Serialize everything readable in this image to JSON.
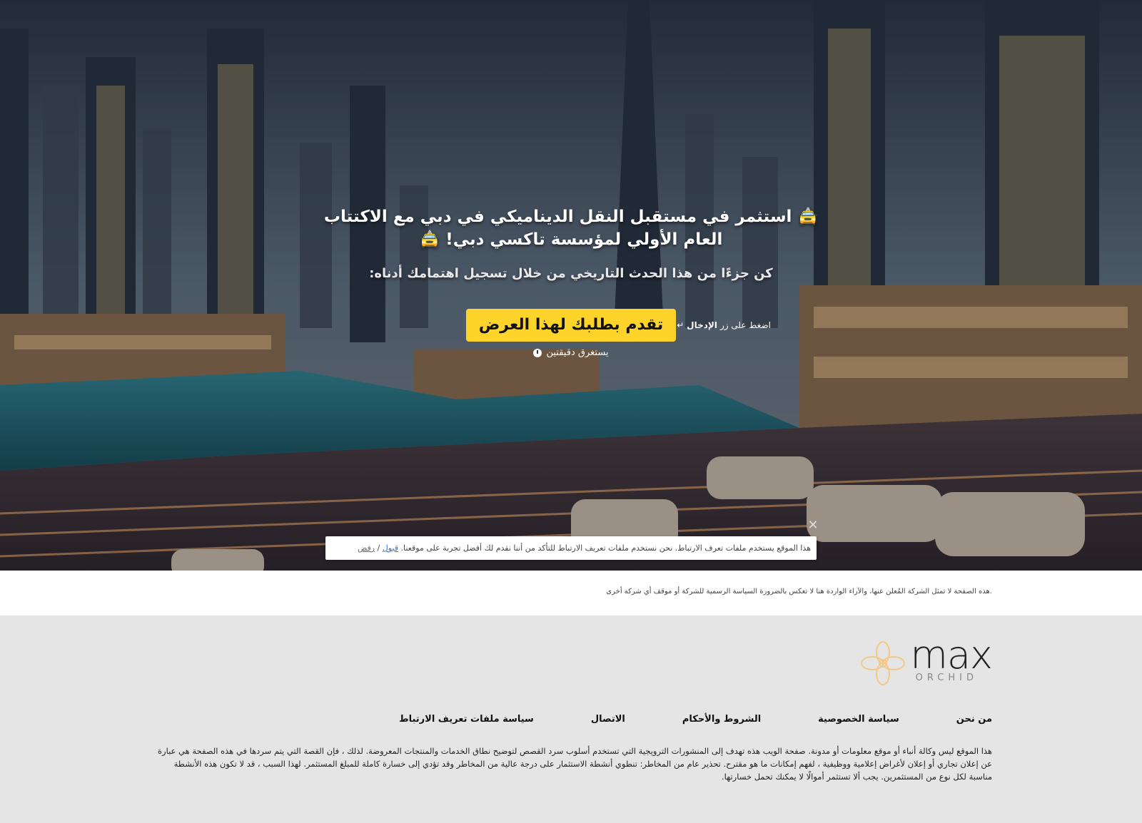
{
  "hero": {
    "title": "🚖 استثمر في مستقبل النقل الديناميكي في دبي مع الاكتتاب العام الأولي لمؤسسة تاكسي دبي! 🚖",
    "subtitle": "كن جزءًا من هذا الحدث التاريخي من خلال تسجيل اهتمامك أدناه:",
    "cta_label": "تقدم بطلبك لهذا العرض",
    "enter_hint_prefix": "اضغط على زر",
    "enter_hint_key": "الإدخال",
    "enter_icon": "↵",
    "duration_text": "يستغرق دقيقتين",
    "colors": {
      "cta_bg": "#ffd42a",
      "cta_text": "#111111"
    }
  },
  "cookie": {
    "text": "هذا الموقع يستخدم ملفات تعرف الارتباط. نحن نستخدم ملفات تعريف الارتباط للتأكد من أننا نقدم لك أفضل تجربة على موقعنا.",
    "accept_label": "قبول",
    "separator": "/",
    "reject_label": "رفض",
    "close_icon": "close-icon"
  },
  "disclaimer": {
    "text": ".هذه الصفحة لا تمثل الشركة المُعلن عنها، والآراء الواردة هنا لا تعكس بالضرورة السياسة الرسمية للشركة أو موقف أي شركة أخرى"
  },
  "footer": {
    "logo_word": "max",
    "logo_sub": "ORCHID",
    "nav": [
      {
        "label": "من نحن"
      },
      {
        "label": "سياسة الخصوصية"
      },
      {
        "label": "الشروط والأحكام"
      },
      {
        "label": "الاتصال"
      },
      {
        "label": "سياسة ملفات تعريف الارتباط"
      }
    ],
    "text": "هذا الموقع ليس وكالة أنباء أو موقع معلومات أو مدونة. صفحة الويب هذه تهدف إلى المنشورات الترويجية التي تستخدم أسلوب سرد القصص لتوضيح نطاق الخدمات والمنتجات المعروضة. لذلك ، فإن القصة التي يتم سردها في هذه الصفحة هي عبارة عن إعلان تجاري أو إعلان لأغراض إعلامية ووظيفية ، لفهم إمكانات ما هو مقترح. تحذير عام من المخاطر: تنطوي أنشطة الاستثمار على درجة عالية من المخاطر وقد تؤدي إلى خسارة كاملة للمبلغ المستثمر. لهذا السبب ، قد لا تكون هذه الأنشطة مناسبة لكل نوع من المستثمرين. يجب ألا تستثمر أموالًا لا يمكنك تحمل خسارتها."
  }
}
